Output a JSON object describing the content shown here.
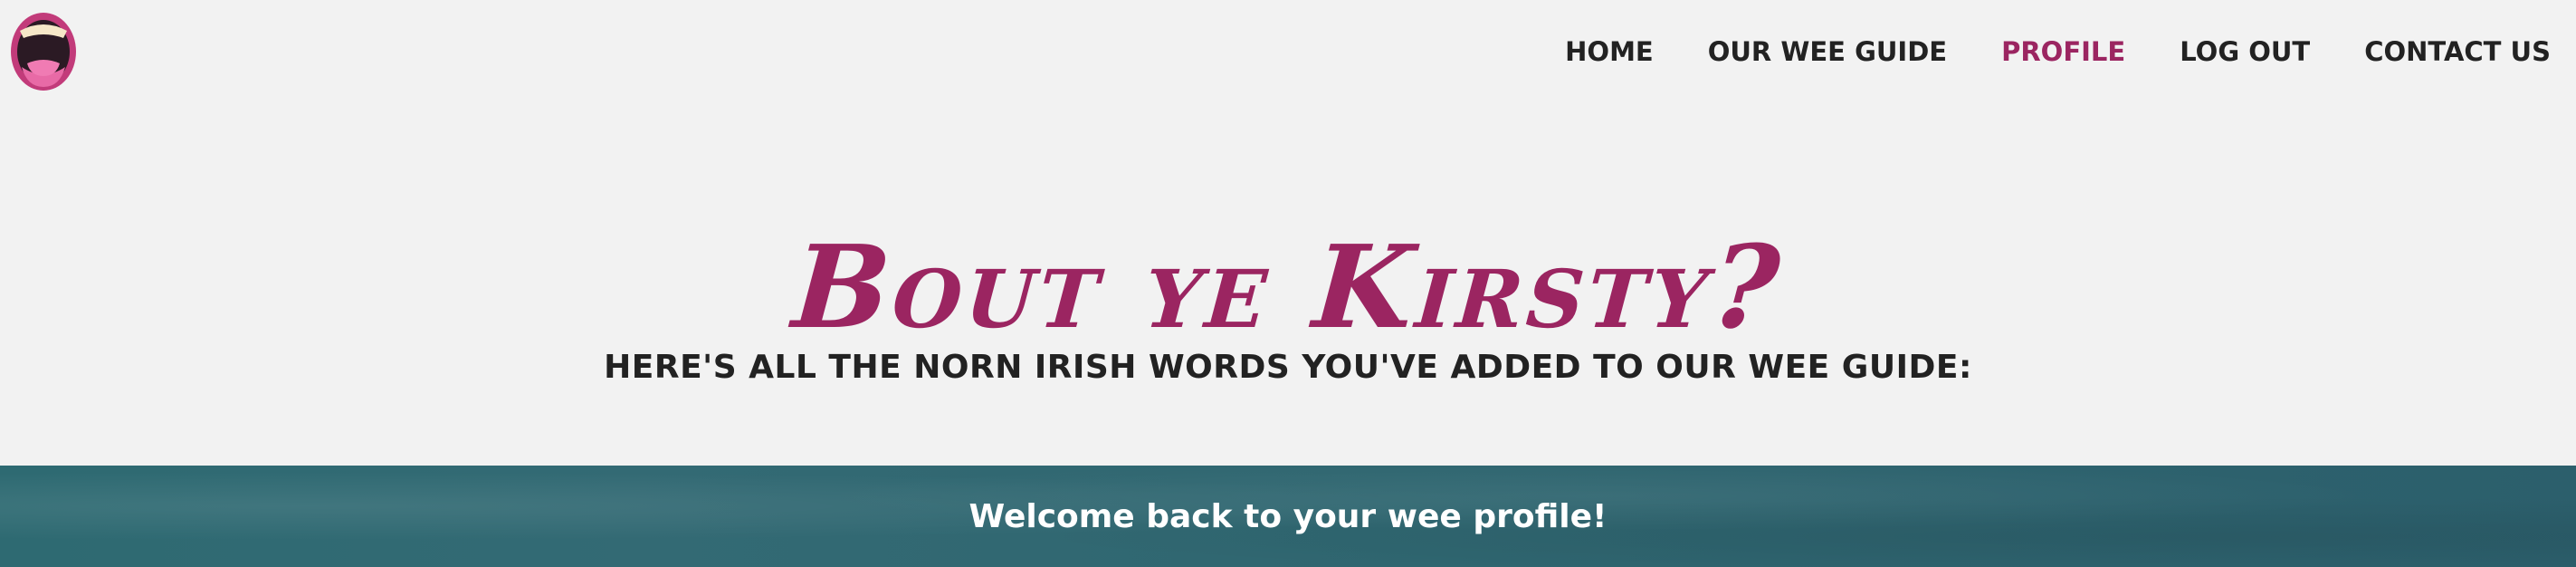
{
  "header": {
    "logo_icon": "open-mouth-icon",
    "nav": [
      {
        "label": "HOME",
        "active": false
      },
      {
        "label": "OUR WEE GUIDE",
        "active": false
      },
      {
        "label": "PROFILE",
        "active": true
      },
      {
        "label": "LOG OUT",
        "active": false
      },
      {
        "label": "CONTACT US",
        "active": false
      }
    ]
  },
  "main": {
    "title": "Bout ye Kirsty?",
    "subtitle": "HERE'S ALL THE NORN IRISH WORDS YOU'VE ADDED TO OUR WEE GUIDE:"
  },
  "banner": {
    "text": "Welcome back to your wee profile!"
  },
  "colors": {
    "accent": "#9b2561",
    "background": "#f2f2f2",
    "text": "#222222",
    "banner": "#2f6670"
  }
}
